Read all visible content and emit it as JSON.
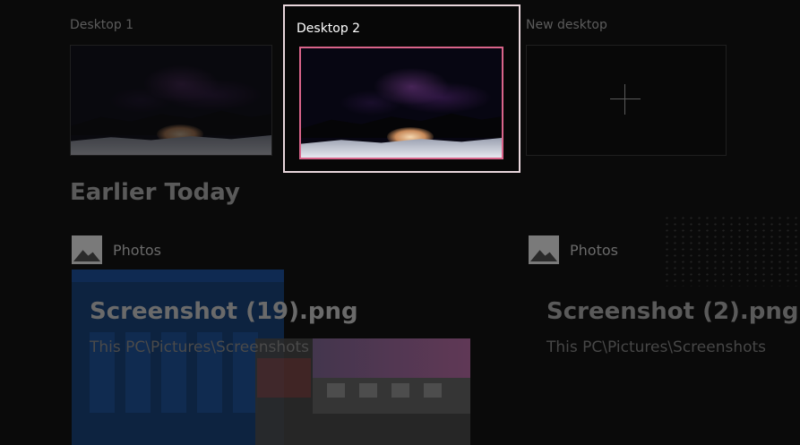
{
  "desktops": [
    {
      "label": "Desktop 1",
      "active": false
    },
    {
      "label": "Desktop 2",
      "active": true
    },
    {
      "label": "New desktop",
      "icon": "plus-icon"
    }
  ],
  "timeline": {
    "heading": "Earlier Today",
    "cards": [
      {
        "app": "Photos",
        "app_icon": "photos-icon",
        "title": "Screenshot (19).png",
        "path": "This PC\\Pictures\\Screenshots"
      },
      {
        "app": "Photos",
        "app_icon": "photos-icon",
        "title": "Screenshot (2).png",
        "path": "This PC\\Pictures\\Screenshots"
      }
    ]
  },
  "colors": {
    "active_border": "#e8d6dc",
    "active_thumb_border": "#d9648a",
    "background": "#050505"
  }
}
